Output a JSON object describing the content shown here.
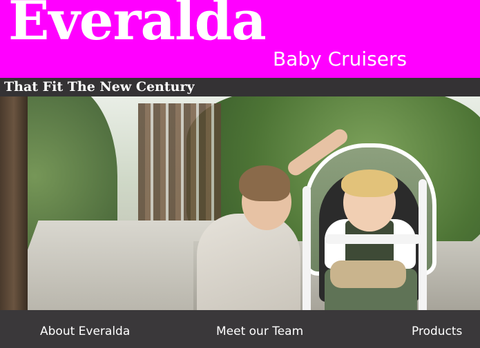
{
  "header": {
    "logo_text": "Everalda",
    "tagline": "Baby Cruisers",
    "background_color": "#ff00ff"
  },
  "slogan": {
    "text": "That Fit The New Century"
  },
  "hero": {
    "image_subject": "mother-with-baby-in-stroller-photo"
  },
  "nav": {
    "items": [
      {
        "label": "About Everalda"
      },
      {
        "label": "Meet our Team"
      },
      {
        "label": "Products"
      }
    ],
    "background_color": "#3a383a"
  }
}
